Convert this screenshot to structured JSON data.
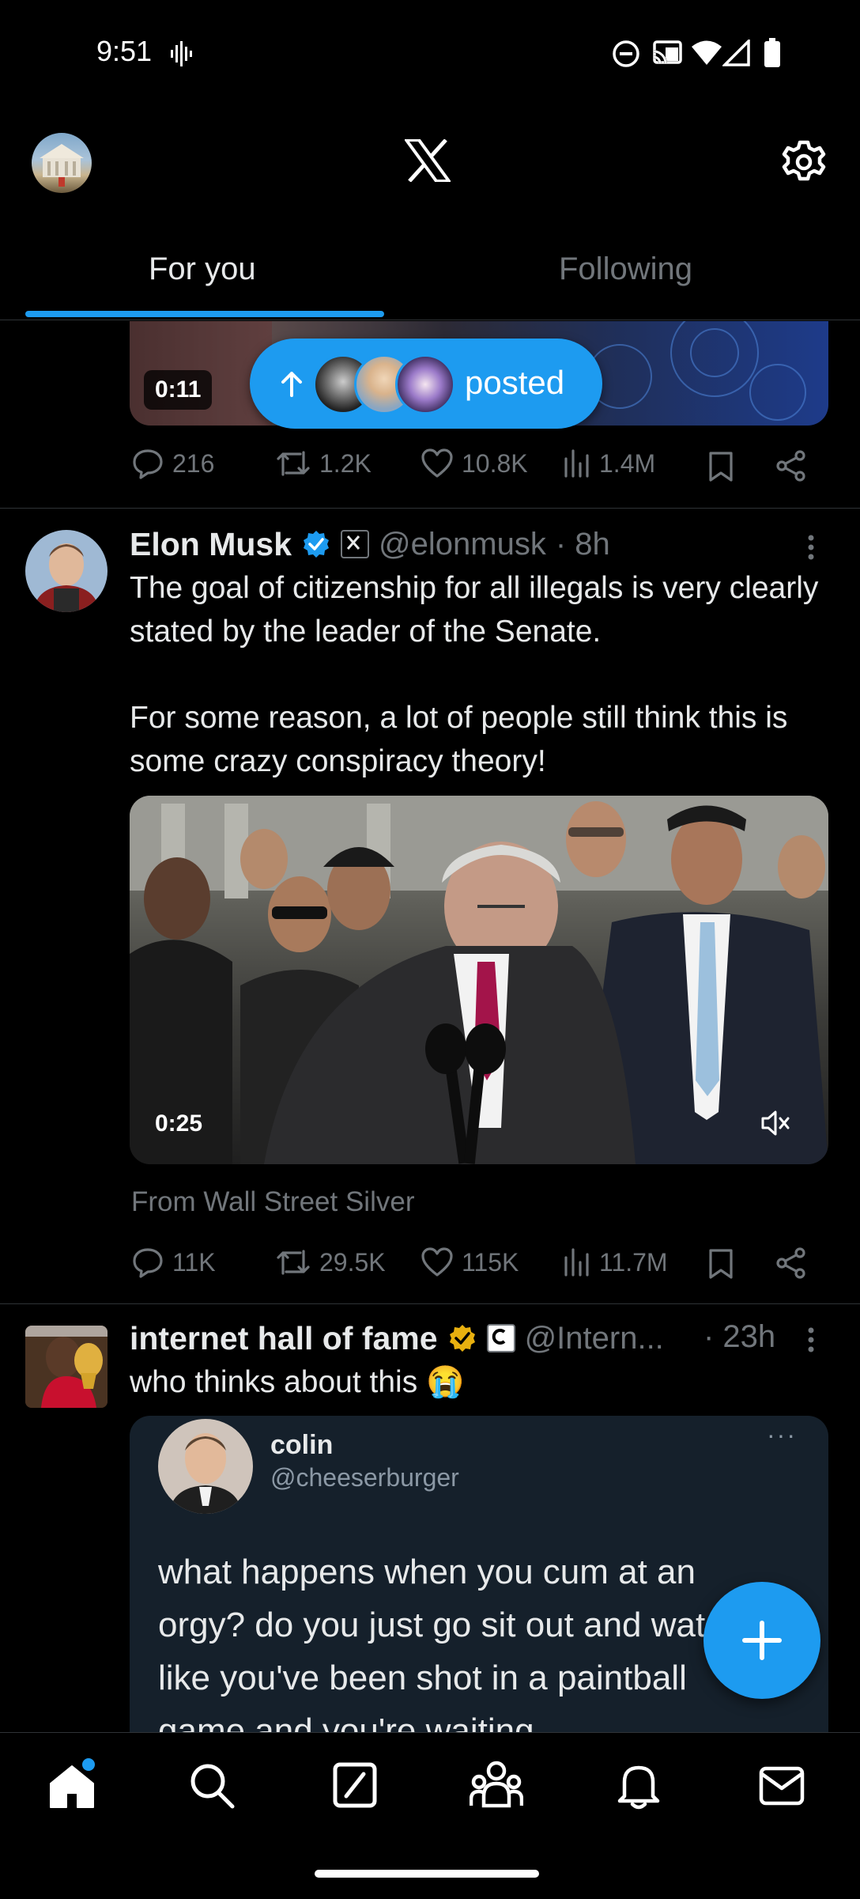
{
  "status_bar": {
    "time": "9:51"
  },
  "header": {
    "logo_label": "X"
  },
  "tabs": [
    {
      "label": "For you",
      "active": true
    },
    {
      "label": "Following",
      "active": false
    }
  ],
  "posted_pill": {
    "label": "posted"
  },
  "tweet1": {
    "video_duration": "0:11",
    "stats": {
      "replies": "216",
      "reposts": "1.2K",
      "likes": "10.8K",
      "views": "1.4M"
    }
  },
  "tweet2": {
    "name": "Elon Musk",
    "handle": "@elonmusk",
    "time": "· 8h",
    "text_p1": "The goal of citizenship for all illegals is very clearly stated by the leader of the Senate.",
    "text_p2": "For some reason, a lot of people still think this is some crazy conspiracy theory!",
    "video_duration": "0:25",
    "source": "From Wall Street Silver",
    "stats": {
      "replies": "11K",
      "reposts": "29.5K",
      "likes": "115K",
      "views": "11.7M"
    }
  },
  "tweet3": {
    "name": "internet hall of fame",
    "handle": "@Intern...",
    "time": "· 23h",
    "text": "who thinks about this 😭",
    "embed": {
      "name": "colin",
      "handle": "@cheeserburger",
      "text": "what happens when you cum at an orgy? do you just go sit out and watch like you've been shot in a paintball game and you're waiting"
    }
  },
  "colors": {
    "accent": "#1d9bf0",
    "background": "#000000",
    "muted": "#71767b",
    "gold": "#e8b00f"
  }
}
